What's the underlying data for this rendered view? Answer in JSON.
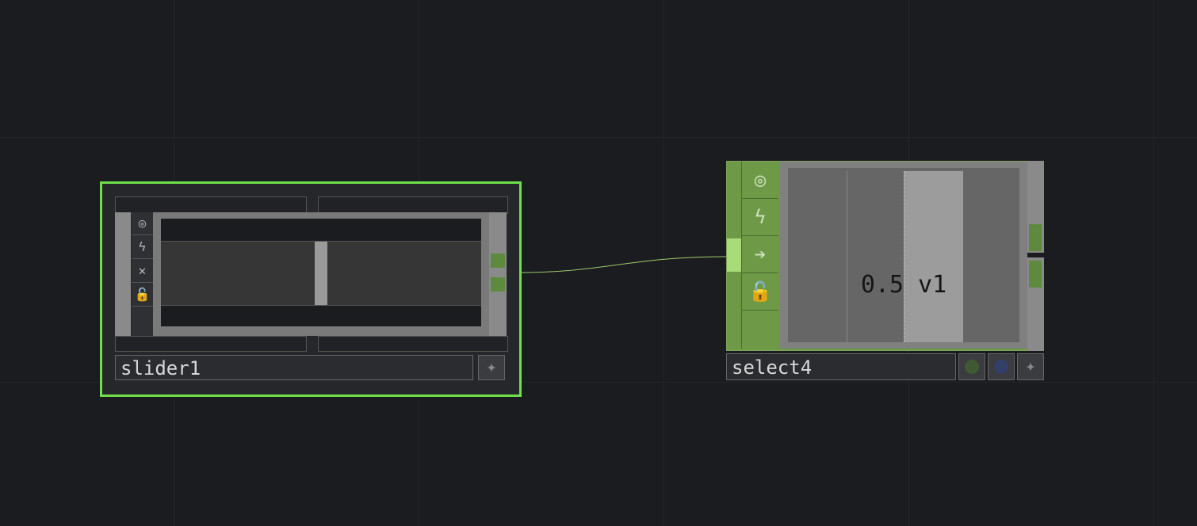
{
  "nodes": {
    "slider": {
      "name": "slider1",
      "value": 0.5,
      "icons": [
        "target-icon",
        "pulse-icon",
        "close-icon",
        "lock-icon"
      ],
      "icon_glyphs": [
        "◎",
        "ϟ",
        "✕",
        "🔓"
      ],
      "star_glyph": "✦",
      "border_color": "#6fe04a"
    },
    "select": {
      "name": "select4",
      "value_label": "0.5 v1",
      "icons": [
        "target-icon",
        "pulse-icon",
        "arrow-right-icon",
        "lock-icon"
      ],
      "icon_glyphs": [
        "◎",
        "ϟ",
        "➔",
        "🔓"
      ],
      "star_glyph": "✦",
      "flag_colors": [
        "#3f5a33",
        "#33406a"
      ],
      "body_color": "#6e9a48"
    }
  },
  "wire": {
    "from": "slider1",
    "to": "select4",
    "color": "#9ccc6a"
  }
}
